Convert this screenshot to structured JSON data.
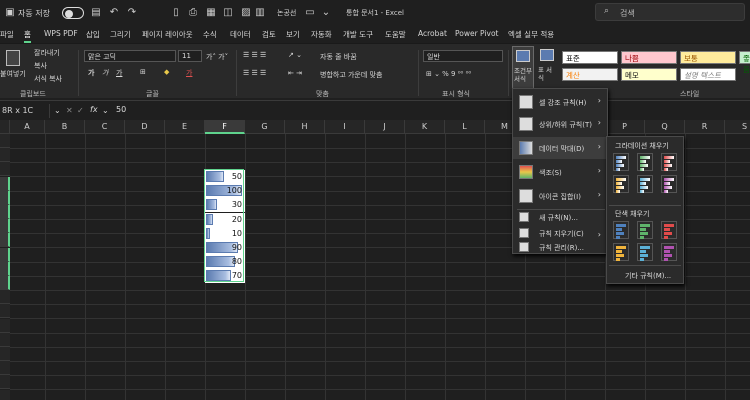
{
  "title_bar": {
    "autosave_label": "자동 저장",
    "autosave_state": "끔",
    "file_tag": "논공선",
    "document_title": "통합 문서1 - Excel",
    "search_placeholder": "검색"
  },
  "tabs": [
    "파일",
    "홈",
    "WPS PDF",
    "삽입",
    "그리기",
    "페이지 레이아웃",
    "수식",
    "데이터",
    "검토",
    "보기",
    "자동화",
    "개발 도구",
    "도움말",
    "Acrobat",
    "Power Pivot",
    "엑셀 실무 적용"
  ],
  "active_tab": "홈",
  "ribbon": {
    "clipboard": {
      "paste": "붙여넣기",
      "cut": "잘라내기",
      "copy": "복사",
      "format_painter": "서식 복사",
      "label": "클립보드"
    },
    "font": {
      "name": "맑은 고딕",
      "size": "11",
      "label": "글꼴"
    },
    "alignment": {
      "wrap": "자동 줄 바꿈",
      "merge": "병합하고 가운데 맞춤",
      "label": "맞춤"
    },
    "number": {
      "format": "일반",
      "label": "표시 형식"
    },
    "styles": {
      "conditional": "조건부 서식",
      "table": "표 서식",
      "cells": [
        "표준",
        "나쁨",
        "보통",
        "좋음",
        "계산",
        "메모",
        "설명 텍스트"
      ],
      "label": "스타일"
    }
  },
  "formula_bar": {
    "name_box": "8R x 1C",
    "fx": "fx",
    "value": "50"
  },
  "columns": [
    "A",
    "B",
    "C",
    "D",
    "E",
    "F",
    "G",
    "H",
    "I",
    "J",
    "K",
    "L",
    "M",
    "N",
    "O",
    "P",
    "Q",
    "R",
    "S"
  ],
  "selected_column": "F",
  "data_values": [
    50,
    100,
    30,
    20,
    10,
    90,
    80,
    70
  ],
  "data_max": 100,
  "cf_menu": {
    "items": [
      {
        "label": "셀 강조 규칙(H)",
        "has_sub": true
      },
      {
        "label": "상위/하위 규칙(T)",
        "has_sub": true
      },
      {
        "label": "데이터 막대(D)",
        "has_sub": true
      },
      {
        "label": "색조(S)",
        "has_sub": true
      },
      {
        "label": "아이콘 집합(I)",
        "has_sub": true
      }
    ],
    "small_items": [
      {
        "label": "새 규칙(N)...",
        "has_sub": false
      },
      {
        "label": "규칙 지우기(C)",
        "has_sub": true
      },
      {
        "label": "규칙 관리(R)...",
        "has_sub": false
      }
    ]
  },
  "databar_submenu": {
    "gradient_label": "그라데이션 채우기",
    "solid_label": "단색 채우기",
    "more_rules": "기타 규칙(M)...",
    "colors": [
      "#4f81bd",
      "#5fb36b",
      "#e04b4b",
      "#f0b43c",
      "#5bb0d6",
      "#b052b0"
    ]
  }
}
